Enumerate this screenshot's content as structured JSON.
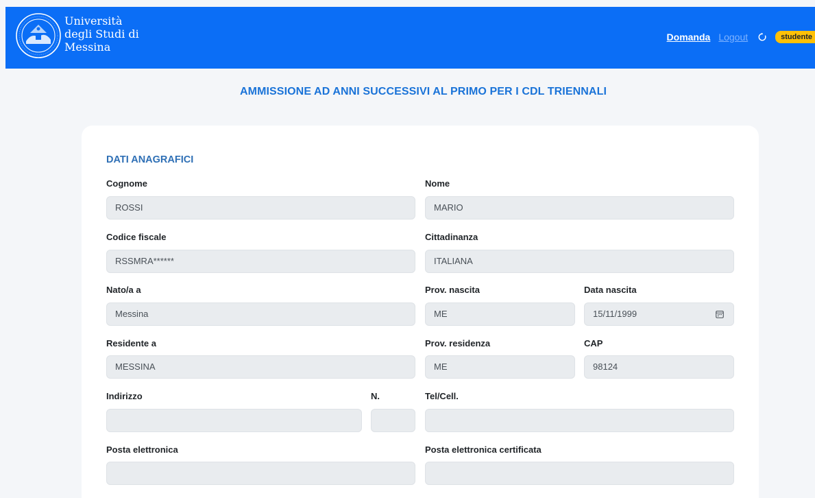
{
  "header": {
    "brand_lines": [
      "Università",
      "degli Studi di",
      "Messina"
    ],
    "nav_domanda": "Domanda",
    "nav_logout": "Logout",
    "user_badge": "studente"
  },
  "page": {
    "title": "AMMISSIONE AD ANNI SUCCESSIVI AL PRIMO PER I CDL TRIENNALI"
  },
  "form": {
    "section_title": "DATI ANAGRAFICI",
    "cognome": {
      "label": "Cognome",
      "value": "ROSSI"
    },
    "nome": {
      "label": "Nome",
      "value": "MARIO"
    },
    "codice_fiscale": {
      "label": "Codice fiscale",
      "value": "RSSMRA******"
    },
    "cittadinanza": {
      "label": "Cittadinanza",
      "value": "ITALIANA"
    },
    "nato_a": {
      "label": "Nato/a a",
      "value": "Messina"
    },
    "prov_nascita": {
      "label": "Prov. nascita",
      "value": "ME"
    },
    "data_nascita": {
      "label": "Data nascita",
      "value": "15/11/1999"
    },
    "residente_a": {
      "label": "Residente a",
      "value": "MESSINA"
    },
    "prov_residenza": {
      "label": "Prov. residenza",
      "value": "ME"
    },
    "cap": {
      "label": "CAP",
      "value": "98124"
    },
    "indirizzo": {
      "label": "Indirizzo",
      "value": ""
    },
    "numero": {
      "label": "N.",
      "value": ""
    },
    "tel": {
      "label": "Tel/Cell.",
      "value": ""
    },
    "email": {
      "label": "Posta elettronica",
      "value": ""
    },
    "pec": {
      "label": "Posta elettronica certificata",
      "value": ""
    }
  },
  "colors": {
    "navbar": "#0b6ef6",
    "title": "#1a73d8",
    "section": "#2e6fb5",
    "badge": "#ffc107"
  },
  "icons": [
    "university-seal-icon",
    "reload-icon",
    "calendar-icon"
  ]
}
